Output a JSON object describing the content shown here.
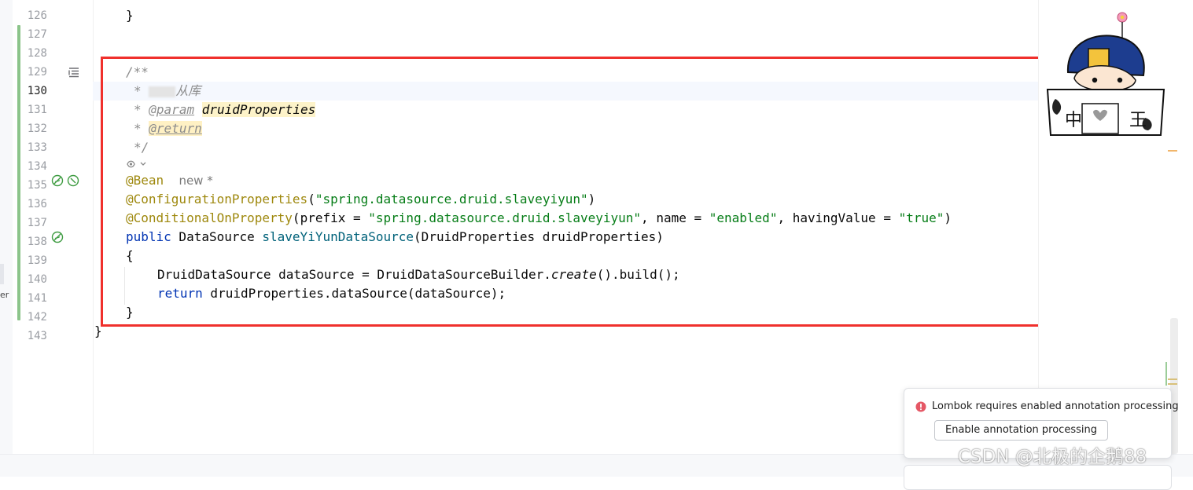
{
  "editor": {
    "line_numbers": [
      "126",
      "127",
      "128",
      "129",
      "130",
      "131",
      "132",
      "133",
      "134",
      "135",
      "136",
      "137",
      "138",
      "139",
      "140",
      "141",
      "142",
      "143"
    ],
    "current_line": "130",
    "code": {
      "l126": {
        "brace": "}"
      },
      "l129": {
        "text": "/**"
      },
      "l130": {
        "star": "*",
        "text": "从库"
      },
      "l131": {
        "star": "*",
        "tag": "@param",
        "param": "druidProperties"
      },
      "l132": {
        "star": "*",
        "tag": "@return"
      },
      "l133": {
        "text": "*/"
      },
      "l134": {
        "annotation": "@Bean",
        "hint": "new *"
      },
      "l135": {
        "annotation": "@ConfigurationProperties",
        "open": "(",
        "str": "\"spring.datasource.druid.slaveyiyun\"",
        "close": ")"
      },
      "l136": {
        "annotation": "@ConditionalOnProperty",
        "open": "(",
        "p1": "prefix = ",
        "s1": "\"spring.datasource.druid.slaveyiyun\"",
        "p2": ", name = ",
        "s2": "\"enabled\"",
        "p3": ", havingValue = ",
        "s3": "\"true\"",
        "close": ")"
      },
      "l137": {
        "kw": "public",
        "type": " DataSource ",
        "method": "slaveYiYunDataSource",
        "params": "(DruidProperties druidProperties)"
      },
      "l138": {
        "brace": "{"
      },
      "l139": {
        "pre": "DruidDataSource dataSource = DruidDataSourceBuilder.",
        "call": "create",
        "post": "().build();"
      },
      "l140": {
        "kw": "return",
        "rest": " druidProperties.dataSource(dataSource);"
      },
      "l141": {
        "brace": "}"
      },
      "l142": {
        "brace": "}"
      }
    }
  },
  "sidebar": {
    "fragment": "er"
  },
  "notification": {
    "message": "Lombok requires enabled annotation processing",
    "button": "Enable annotation processing",
    "level_color": "#e55765"
  },
  "mascot": {
    "left": "中",
    "right": "王"
  },
  "watermark": "CSDN @北极的企鹅88",
  "colors": {
    "highlight_box": "#f0302c",
    "vcs_added": "#8bc48a"
  }
}
